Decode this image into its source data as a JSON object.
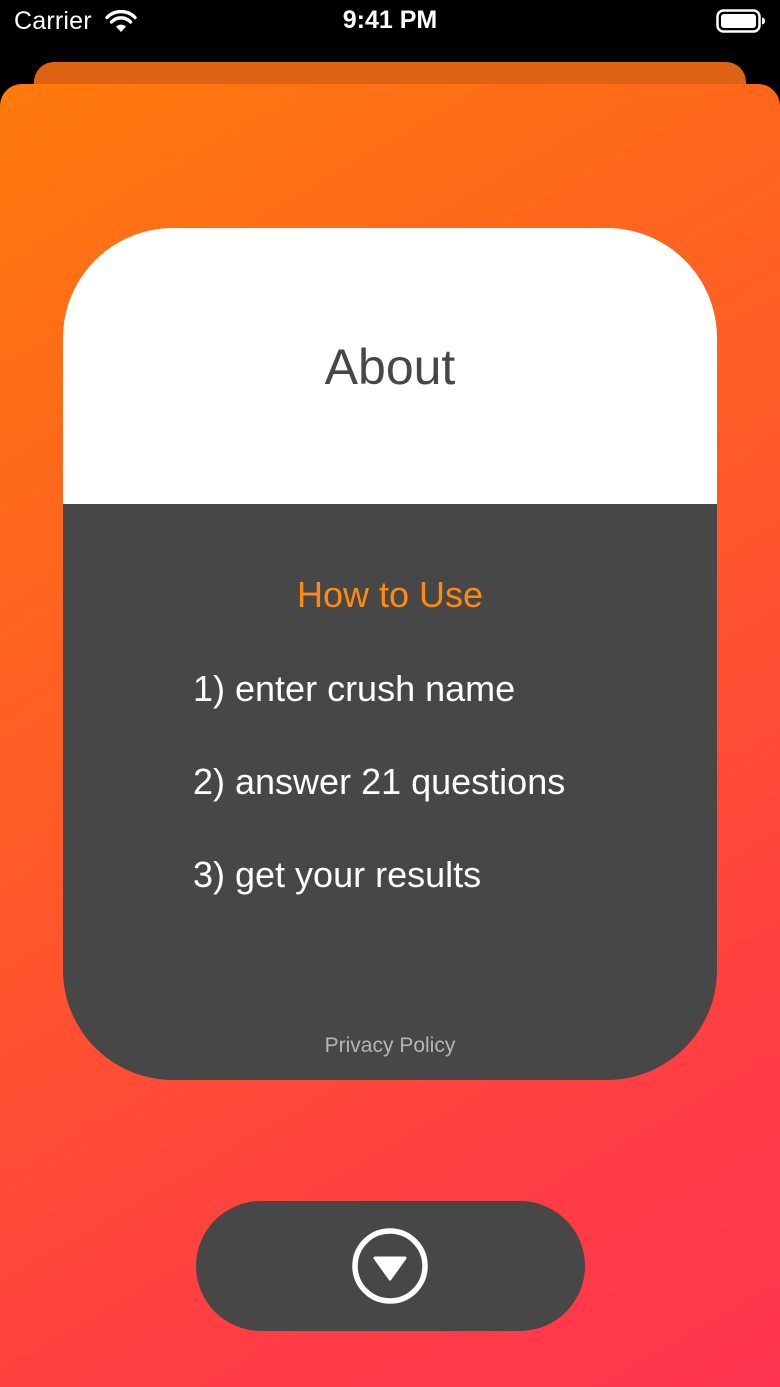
{
  "status_bar": {
    "carrier": "Carrier",
    "time": "9:41 PM"
  },
  "card": {
    "title": "About",
    "how_to_title": "How to Use",
    "steps": [
      "1) enter crush name",
      "2) answer 21 questions",
      "3) get your results"
    ],
    "privacy_label": "Privacy Policy"
  },
  "icons": {
    "wifi": "wifi-icon",
    "battery": "battery-icon",
    "next": "chevron-down-circle-icon"
  },
  "colors": {
    "gradient_start": "#ff7a0c",
    "gradient_end": "#ff3550",
    "card_dark": "#474747",
    "accent_orange": "#ff8a0f"
  }
}
